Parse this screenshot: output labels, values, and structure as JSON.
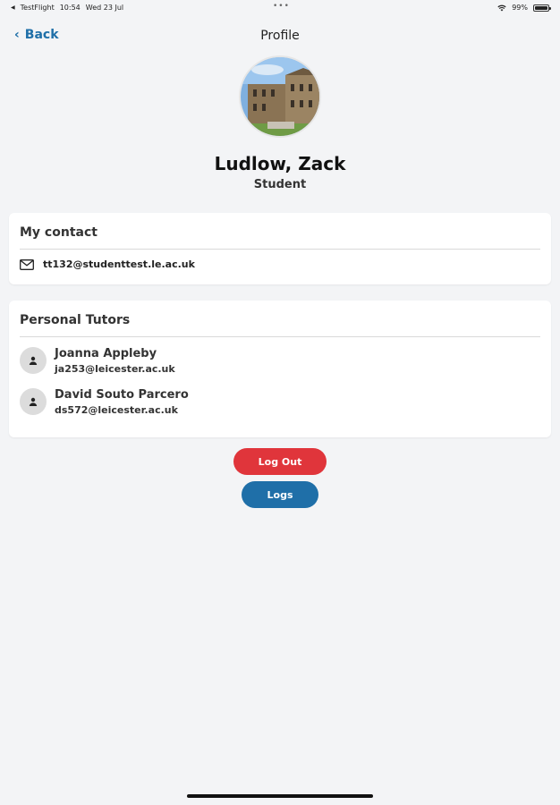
{
  "status_bar": {
    "app": "TestFlight",
    "time": "10:54",
    "date": "Wed 23 Jul",
    "battery": "99%"
  },
  "nav": {
    "back_label": "Back",
    "title": "Profile"
  },
  "profile": {
    "name": "Ludlow, Zack",
    "role": "Student"
  },
  "contact_card": {
    "title": "My contact",
    "email": "tt132@studenttest.le.ac.uk"
  },
  "tutors_card": {
    "title": "Personal Tutors",
    "tutors": [
      {
        "name": "Joanna Appleby",
        "email": "ja253@leicester.ac.uk"
      },
      {
        "name": "David Souto Parcero",
        "email": "ds572@leicester.ac.uk"
      }
    ]
  },
  "buttons": {
    "logout": "Log Out",
    "logs": "Logs"
  },
  "colors": {
    "accent": "#1f6fa8",
    "logout": "#e0353b",
    "background": "#f3f4f6"
  }
}
